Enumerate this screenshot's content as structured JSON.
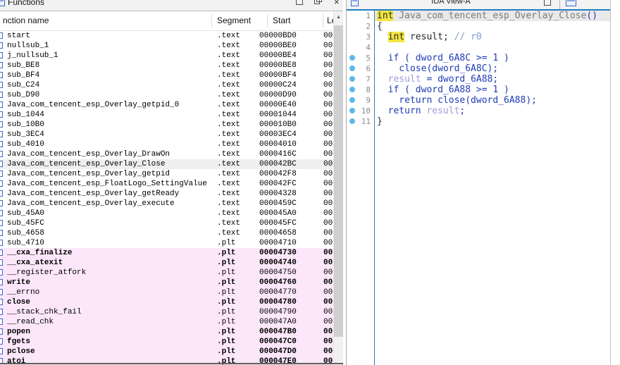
{
  "functions_panel": {
    "title": "Functions",
    "window_buttons": {
      "maximize": "maximize",
      "restore": "restore",
      "close": "×"
    },
    "columns": {
      "name": "nction name",
      "segment": "Segment",
      "start": "Start",
      "length": "Le"
    },
    "scrollbar": {
      "up_arrow": "▲"
    },
    "rows": [
      {
        "name": "start",
        "segment": ".text",
        "start": "00000BD0",
        "length": "00",
        "pink": false,
        "bold": false,
        "selected": false
      },
      {
        "name": "nullsub_1",
        "segment": ".text",
        "start": "00000BE0",
        "length": "00",
        "pink": false,
        "bold": false,
        "selected": false
      },
      {
        "name": "j_nullsub_1",
        "segment": ".text",
        "start": "00000BE4",
        "length": "00",
        "pink": false,
        "bold": false,
        "selected": false
      },
      {
        "name": "sub_BE8",
        "segment": ".text",
        "start": "00000BE8",
        "length": "00",
        "pink": false,
        "bold": false,
        "selected": false
      },
      {
        "name": "sub_BF4",
        "segment": ".text",
        "start": "00000BF4",
        "length": "00",
        "pink": false,
        "bold": false,
        "selected": false
      },
      {
        "name": "sub_C24",
        "segment": ".text",
        "start": "00000C24",
        "length": "00",
        "pink": false,
        "bold": false,
        "selected": false
      },
      {
        "name": "sub_D90",
        "segment": ".text",
        "start": "00000D90",
        "length": "00",
        "pink": false,
        "bold": false,
        "selected": false
      },
      {
        "name": "Java_com_tencent_esp_Overlay_getpid_0",
        "segment": ".text",
        "start": "00000E40",
        "length": "00",
        "pink": false,
        "bold": false,
        "selected": false
      },
      {
        "name": "sub_1044",
        "segment": ".text",
        "start": "00001044",
        "length": "00",
        "pink": false,
        "bold": false,
        "selected": false
      },
      {
        "name": "sub_10B0",
        "segment": ".text",
        "start": "000010B0",
        "length": "00",
        "pink": false,
        "bold": false,
        "selected": false
      },
      {
        "name": "sub_3EC4",
        "segment": ".text",
        "start": "00003EC4",
        "length": "00",
        "pink": false,
        "bold": false,
        "selected": false
      },
      {
        "name": "sub_4010",
        "segment": ".text",
        "start": "00004010",
        "length": "00",
        "pink": false,
        "bold": false,
        "selected": false
      },
      {
        "name": "Java_com_tencent_esp_Overlay_DrawOn",
        "segment": ".text",
        "start": "0000416C",
        "length": "00",
        "pink": false,
        "bold": false,
        "selected": false
      },
      {
        "name": "Java_com_tencent_esp_Overlay_Close",
        "segment": ".text",
        "start": "000042BC",
        "length": "00",
        "pink": false,
        "bold": false,
        "selected": true
      },
      {
        "name": "Java_com_tencent_esp_Overlay_getpid",
        "segment": ".text",
        "start": "000042F8",
        "length": "00",
        "pink": false,
        "bold": false,
        "selected": false
      },
      {
        "name": "Java_com_tencent_esp_FloatLogo_SettingValue",
        "segment": ".text",
        "start": "000042FC",
        "length": "00",
        "pink": false,
        "bold": false,
        "selected": false
      },
      {
        "name": "Java_com_tencent_esp_Overlay_getReady",
        "segment": ".text",
        "start": "00004328",
        "length": "00",
        "pink": false,
        "bold": false,
        "selected": false
      },
      {
        "name": "Java_com_tencent_esp_Overlay_execute",
        "segment": ".text",
        "start": "0000459C",
        "length": "00",
        "pink": false,
        "bold": false,
        "selected": false
      },
      {
        "name": "sub_45A0",
        "segment": ".text",
        "start": "000045A0",
        "length": "00",
        "pink": false,
        "bold": false,
        "selected": false
      },
      {
        "name": "sub_45FC",
        "segment": ".text",
        "start": "000045FC",
        "length": "00",
        "pink": false,
        "bold": false,
        "selected": false
      },
      {
        "name": "sub_4658",
        "segment": ".text",
        "start": "00004658",
        "length": "00",
        "pink": false,
        "bold": false,
        "selected": false
      },
      {
        "name": "sub_4710",
        "segment": ".plt",
        "start": "00004710",
        "length": "00",
        "pink": false,
        "bold": false,
        "selected": false
      },
      {
        "name": "__cxa_finalize",
        "segment": ".plt",
        "start": "00004730",
        "length": "00",
        "pink": true,
        "bold": true,
        "selected": false
      },
      {
        "name": "__cxa_atexit",
        "segment": ".plt",
        "start": "00004740",
        "length": "00",
        "pink": true,
        "bold": true,
        "selected": false
      },
      {
        "name": "__register_atfork",
        "segment": ".plt",
        "start": "00004750",
        "length": "00",
        "pink": true,
        "bold": false,
        "selected": false
      },
      {
        "name": "write",
        "segment": ".plt",
        "start": "00004760",
        "length": "00",
        "pink": true,
        "bold": true,
        "selected": false
      },
      {
        "name": "__errno",
        "segment": ".plt",
        "start": "00004770",
        "length": "00",
        "pink": true,
        "bold": false,
        "selected": false
      },
      {
        "name": "close",
        "segment": ".plt",
        "start": "00004780",
        "length": "00",
        "pink": true,
        "bold": true,
        "selected": false
      },
      {
        "name": "__stack_chk_fail",
        "segment": ".plt",
        "start": "00004790",
        "length": "00",
        "pink": true,
        "bold": false,
        "selected": false
      },
      {
        "name": "__read_chk",
        "segment": ".plt",
        "start": "000047A0",
        "length": "00",
        "pink": true,
        "bold": false,
        "selected": false
      },
      {
        "name": "popen",
        "segment": ".plt",
        "start": "000047B0",
        "length": "00",
        "pink": true,
        "bold": true,
        "selected": false
      },
      {
        "name": "fgets",
        "segment": ".plt",
        "start": "000047C0",
        "length": "00",
        "pink": true,
        "bold": true,
        "selected": false
      },
      {
        "name": "pclose",
        "segment": ".plt",
        "start": "000047D0",
        "length": "00",
        "pink": true,
        "bold": true,
        "selected": false
      },
      {
        "name": "atoi",
        "segment": ".plt",
        "start": "000047E0",
        "length": "00",
        "pink": true,
        "bold": true,
        "selected": false
      }
    ]
  },
  "ida_view_panel": {
    "title": "IDA View-A",
    "code": {
      "lines": [
        {
          "num": "1",
          "dot": false,
          "current": true,
          "tokens": [
            [
              "hl",
              "int"
            ],
            [
              "fn",
              " Java_com_tencent_esp_Overlay_Close"
            ],
            [
              "kw",
              "()"
            ]
          ]
        },
        {
          "num": "2",
          "dot": false,
          "current": false,
          "tokens": [
            [
              "pl",
              "{"
            ]
          ]
        },
        {
          "num": "3",
          "dot": false,
          "current": false,
          "tokens": [
            [
              "pl",
              "  "
            ],
            [
              "hl",
              "int"
            ],
            [
              "pl",
              " result; "
            ],
            [
              "cm",
              "// "
            ],
            [
              "cmr",
              "r0"
            ]
          ]
        },
        {
          "num": "4",
          "dot": false,
          "current": false,
          "tokens": []
        },
        {
          "num": "5",
          "dot": true,
          "current": false,
          "tokens": [
            [
              "kw",
              "  if ( dword_6A8C >= 1 )"
            ]
          ]
        },
        {
          "num": "6",
          "dot": true,
          "current": false,
          "tokens": [
            [
              "kw",
              "    close(dword_6A8C);"
            ]
          ]
        },
        {
          "num": "7",
          "dot": true,
          "current": false,
          "tokens": [
            [
              "pl",
              "  "
            ],
            [
              "lv",
              "result"
            ],
            [
              "kw",
              " = dword_6A88;"
            ]
          ]
        },
        {
          "num": "8",
          "dot": true,
          "current": false,
          "tokens": [
            [
              "kw",
              "  if ( dword_6A88 >= 1 )"
            ]
          ]
        },
        {
          "num": "9",
          "dot": true,
          "current": false,
          "tokens": [
            [
              "kw",
              "    return close(dword_6A88);"
            ]
          ]
        },
        {
          "num": "10",
          "dot": true,
          "current": false,
          "tokens": [
            [
              "pl",
              "  "
            ],
            [
              "kw",
              "return "
            ],
            [
              "lv",
              "result"
            ],
            [
              "kw",
              ";"
            ]
          ]
        },
        {
          "num": "11",
          "dot": true,
          "current": false,
          "tokens": [
            [
              "pl",
              "}"
            ]
          ]
        }
      ]
    }
  },
  "colors": {
    "import_row_pink": "#fbe7f9",
    "selected_row_gray": "#efefef",
    "highlight_yellow": "#f2e53f",
    "code_keyword_blue": "#1e3cb4",
    "local_var_lavender": "#9c9cda",
    "comment_blue_gray": "#8e9ec6",
    "line_dot_blue": "#5bbaea",
    "title_accent_blue": "#1e7fc6",
    "gutter_separator_blue": "#3b74c4",
    "function_icon_blue": "#3e66cc"
  }
}
